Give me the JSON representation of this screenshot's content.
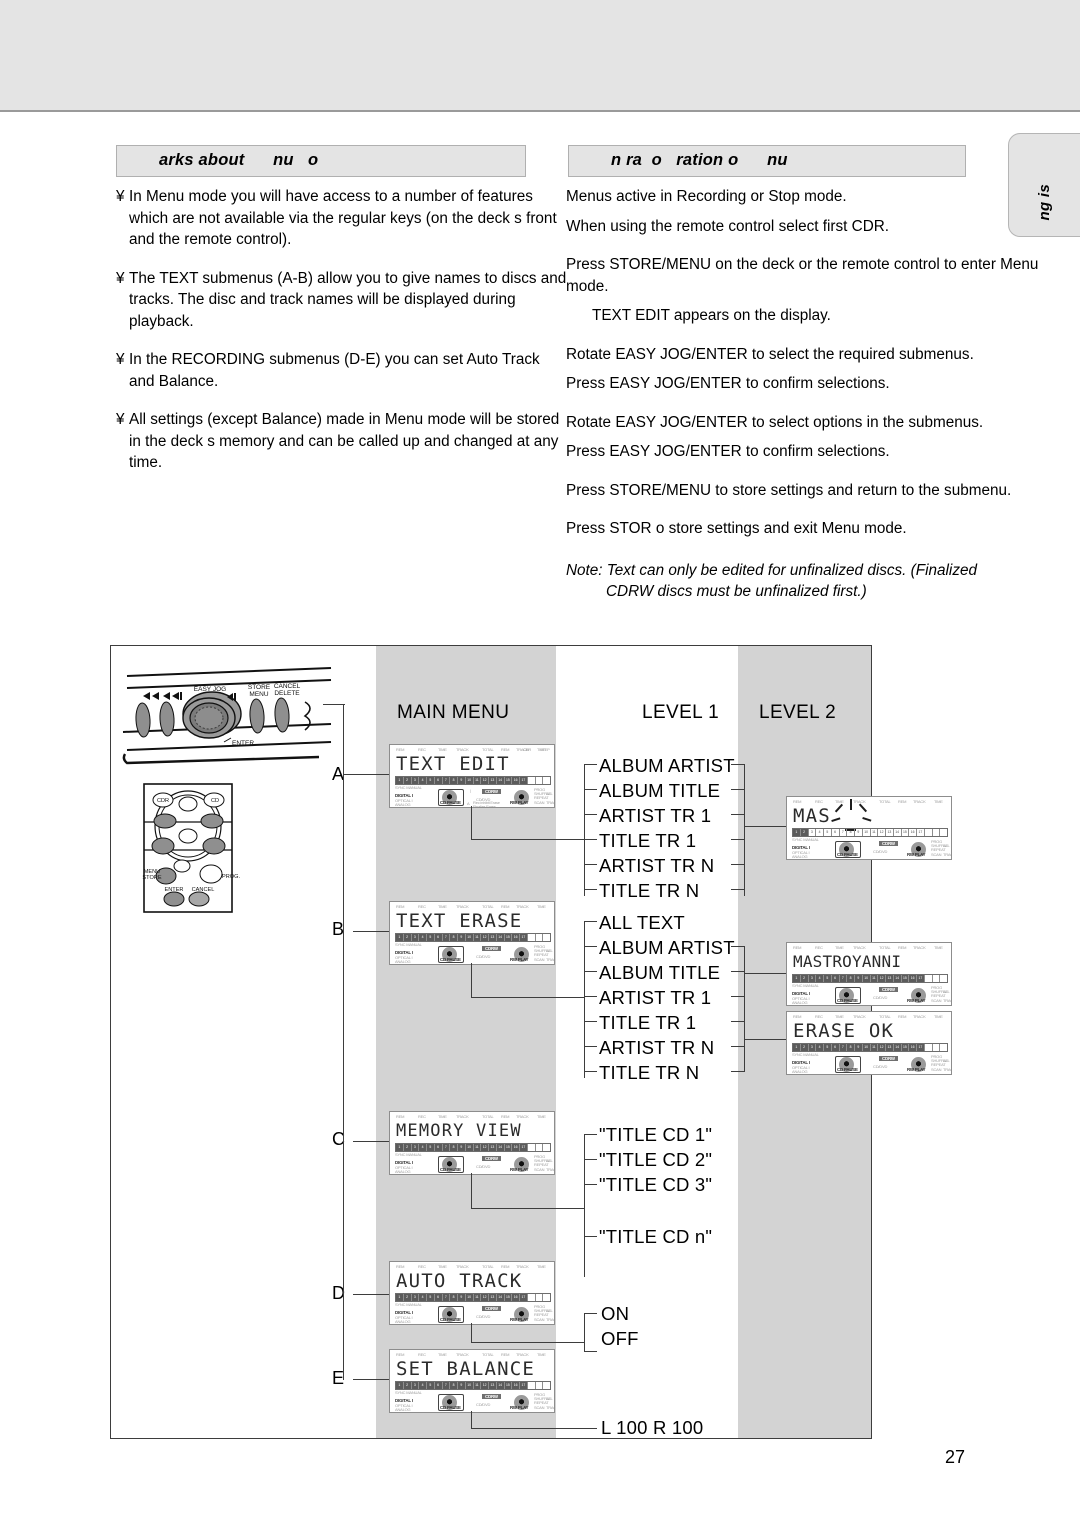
{
  "page": {
    "number": "27"
  },
  "side_tab": {
    "label": "ng is"
  },
  "sections": {
    "left": {
      "heading": "arks about      nu   o",
      "bullets": [
        {
          "marker": "¥",
          "text": "In Menu mode you will have access to a number of features which are not available via the regular keys (on the deck s front and the remote control)."
        },
        {
          "marker": "¥",
          "text": "The TEXT submenus (A-B) allow you to give names to discs and tracks. The disc and track names will be displayed during playback."
        },
        {
          "marker": "¥",
          "text": "In the RECORDING submenus (D-E) you can set Auto Track and Balance."
        },
        {
          "marker": "¥",
          "text": "All settings (except Balance) made in Menu mode will be stored in the deck s memory and can be called up and changed at any time."
        }
      ]
    },
    "right": {
      "heading": "n ra  o   ration o      nu",
      "paragraphs": [
        "Menus active in Recording or Stop mode.",
        "When using the remote control select first CDR.",
        "Press STORE/MENU on the deck or the remote control to enter Menu mode.",
        "TEXT  EDIT appears on the display.",
        "Rotate EASY JOG/ENTER to select the required submenus.",
        "Press EASY JOG/ENTER to confirm selections.",
        "Rotate EASY JOG/ENTER to select options in the submenus.",
        "Press EASY JOG/ENTER to confirm selections.",
        "Press STORE/MENU to store settings and return to the submenu.",
        "Press STOR o store settings and exit Menu mode."
      ],
      "note_line1": "Note: Text can only be edited for unfinalized discs. (Finalized",
      "note_line2": "CDRW discs must be unfinalized first.)"
    }
  },
  "diagram": {
    "column_titles": {
      "main": "MAIN MENU",
      "level1": "LEVEL 1",
      "level2": "LEVEL 2"
    },
    "rows": [
      {
        "letter": "A",
        "display": "TEXT EDIT"
      },
      {
        "letter": "B",
        "display": "TEXT ERASE"
      },
      {
        "letter": "C",
        "display": "MEMORY VIEW"
      },
      {
        "letter": "D",
        "display": "AUTO TRACK"
      },
      {
        "letter": "E",
        "display": "SET BALANCE"
      }
    ],
    "level1": {
      "a_items": [
        "ALBUM ARTIST",
        "ALBUM TITLE",
        "ARTIST TR 1",
        "TITLE TR 1",
        "ARTIST TR N",
        "TITLE TR N"
      ],
      "b_items": [
        "ALL TEXT",
        "ALBUM ARTIST",
        "ALBUM TITLE",
        "ARTIST TR 1",
        "TITLE TR 1",
        "ARTIST TR N",
        "TITLE TR N"
      ],
      "c_items": [
        "\"TITLE CD 1\"",
        "\"TITLE CD 2\"",
        "\"TITLE CD 3\"",
        "\"TITLE CD n\""
      ],
      "d_items": [
        "ON",
        "OFF"
      ],
      "e_items": [
        "L 100 R 100"
      ]
    },
    "level2": {
      "a_display": "MAS",
      "b_display_1": "MASTROYANNI",
      "b_display_2": "ERASE OK"
    },
    "lcd_top_indicators": [
      "REM",
      "REC",
      "TIME",
      "TRACK",
      "TOTAL",
      "REM",
      "TRACK",
      "TIME",
      "CDR",
      "STEP"
    ],
    "lcd_bottom_left": [
      "SYNC MANUAL",
      "DIGITAL I",
      "OPTICAL I",
      "ANALOG"
    ],
    "lcd_bottom_right": [
      "PROG",
      "SHUFFLE",
      "ALL",
      "REPEAT",
      "SCAN",
      "TRACK"
    ],
    "deck_panel": {
      "labels": [
        "EASY JOG",
        "STORE MENU",
        "CANCEL DELETE",
        "ENTER"
      ]
    },
    "remote": {
      "labels": [
        "CDR",
        "CD",
        "MENU STORE",
        "PROG.",
        "ENTER",
        "CANCEL"
      ]
    }
  }
}
